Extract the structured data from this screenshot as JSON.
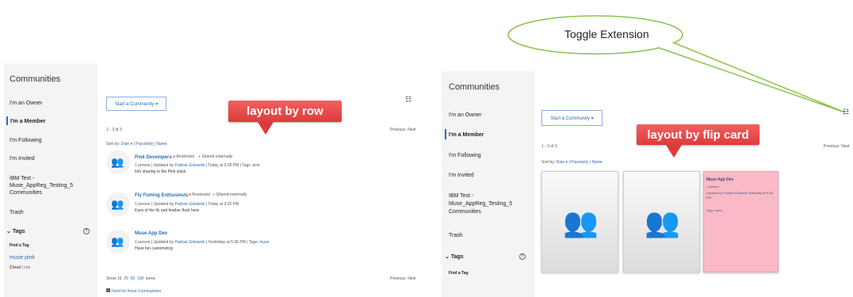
{
  "annotation": {
    "toggle": "Toggle Extension",
    "row_label": "layout by row",
    "flip_label": "layout by flip card"
  },
  "sidebar": {
    "title": "Communities",
    "items": [
      "I'm an Owner",
      "I'm a Member",
      "I'm Following",
      "I'm Invited",
      "IBM Test - Muse_AppReg_Testing_5 Communities",
      "Trash"
    ],
    "tags_label": "Tags",
    "find_tag": "Find a Tag",
    "tag1": "muse",
    "tag2": "pink",
    "cloud": "Cloud",
    "list": "List"
  },
  "main": {
    "start_button": "Start a Community ▾",
    "count": "1 - 3 of 3",
    "previous": "Previous",
    "next": "Next",
    "sort_prefix": "Sort by:",
    "sort_date": "Date ▾",
    "sort_popularity": "Popularity",
    "sort_name": "Name",
    "show": "Show",
    "show_10": "10",
    "show_25": "25",
    "show_50": "50",
    "show_100": "100",
    "items_label": "items",
    "feed": "Feed for these Communities"
  },
  "communities": [
    {
      "name": "Pink Developers",
      "restricted": "Restricted",
      "shared": "Shared externally",
      "meta_prefix": "1 person | Updated by",
      "person": "Padraic Edwards",
      "meta_suffix": "| Today at 3:28 PM | Tags:",
      "tag": "pink",
      "desc": "Info sharing re the Pink stack"
    },
    {
      "name": "Fly Fishing Enthusiests",
      "restricted": "Restricted",
      "shared": "Shared externally",
      "meta_prefix": "1 person | Updated by",
      "person": "Padraic Edwards",
      "meta_suffix": "| Today at 3:25 PM",
      "tag": "",
      "desc": "Fans of the fly and feather flock here"
    },
    {
      "name": "Muse App Dev",
      "restricted": "",
      "shared": "",
      "meta_prefix": "1 person | Updated by",
      "person": "Padraic Edwards",
      "meta_suffix": "| Yesterday at 5:36 PM | Tags:",
      "tag": "muse",
      "desc": "Have fun customizing"
    }
  ],
  "card": {
    "title": "Muse App Dev",
    "people": "1 person",
    "updated_prefix": "Updated by",
    "person": "Padraic Edwards",
    "updated_suffix": "Yesterday at 5:36 PM",
    "tags_prefix": "Tags:",
    "tag": "muse"
  },
  "icons": {
    "view_toggle": "list-grid-toggle-icon",
    "community": "people-group-icon",
    "help": "help-circle-icon",
    "feed": "rss-feed-icon"
  },
  "colors": {
    "link": "#2b6cb0",
    "callout": "#dd3b3b",
    "pink_card": "#f9b9c6",
    "balloon_border": "#8bc34a"
  }
}
